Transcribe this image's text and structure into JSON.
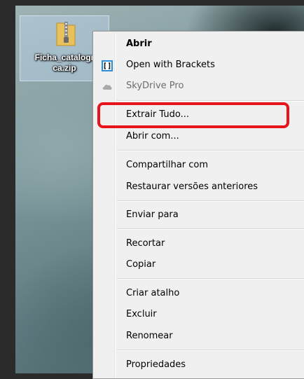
{
  "desktop": {
    "file": {
      "name": "Ficha_catalogr\nca.zip",
      "icon": "zip-folder-icon"
    }
  },
  "context_menu": {
    "items": [
      {
        "label": "Abrir",
        "bold": true
      },
      {
        "label": "Open with Brackets",
        "icon": "brackets-icon"
      },
      {
        "label": "SkyDrive Pro",
        "icon": "cloud-icon",
        "disabled": true,
        "submenu": true
      },
      {
        "label": "Extrair Tudo...",
        "highlighted": true
      },
      {
        "label": "Abrir com..."
      },
      {
        "label": "Compartilhar com",
        "submenu": true
      },
      {
        "label": "Restaurar versões anteriores"
      },
      {
        "label": "Enviar para",
        "submenu": true
      },
      {
        "label": "Recortar"
      },
      {
        "label": "Copiar"
      },
      {
        "label": "Criar atalho"
      },
      {
        "label": "Excluir"
      },
      {
        "label": "Renomear"
      },
      {
        "label": "Propriedades"
      }
    ]
  },
  "colors": {
    "highlight_border": "#e8141b",
    "menu_bg": "#f0f0f0"
  }
}
